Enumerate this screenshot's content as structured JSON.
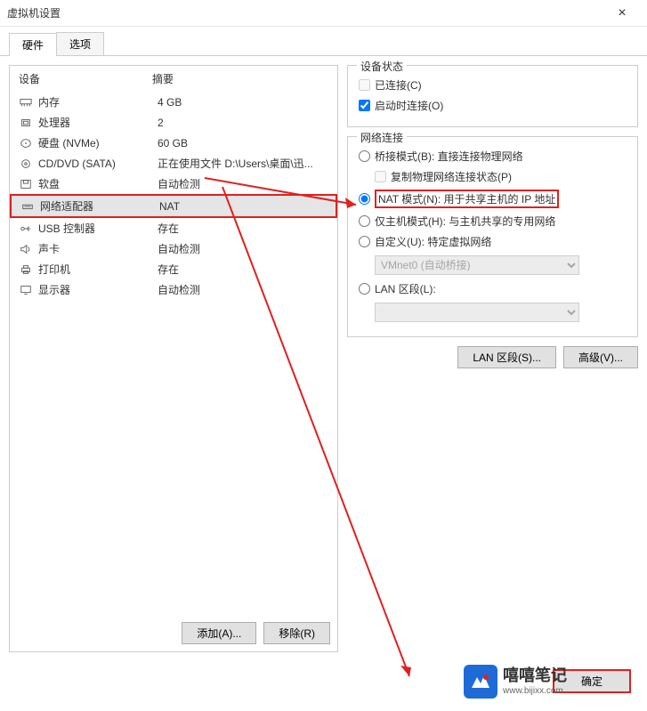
{
  "window": {
    "title": "虚拟机设置",
    "close": "×"
  },
  "tabs": {
    "hardware": "硬件",
    "options": "选项"
  },
  "headers": {
    "device": "设备",
    "summary": "摘要"
  },
  "devices": [
    {
      "name": "内存",
      "summary": "4 GB"
    },
    {
      "name": "处理器",
      "summary": "2"
    },
    {
      "name": "硬盘 (NVMe)",
      "summary": "60 GB"
    },
    {
      "name": "CD/DVD (SATA)",
      "summary": "正在使用文件 D:\\Users\\桌面\\迅..."
    },
    {
      "name": "软盘",
      "summary": "自动检测"
    },
    {
      "name": "网络适配器",
      "summary": "NAT"
    },
    {
      "name": "USB 控制器",
      "summary": "存在"
    },
    {
      "name": "声卡",
      "summary": "自动检测"
    },
    {
      "name": "打印机",
      "summary": "存在"
    },
    {
      "name": "显示器",
      "summary": "自动检测"
    }
  ],
  "leftButtons": {
    "add": "添加(A)...",
    "remove": "移除(R)"
  },
  "statusGroup": {
    "legend": "设备状态",
    "connected": "已连接(C)",
    "connectOnStart": "启动时连接(O)"
  },
  "networkGroup": {
    "legend": "网络连接",
    "bridged": "桥接模式(B): 直接连接物理网络",
    "replicate": "复制物理网络连接状态(P)",
    "nat": "NAT 模式(N): 用于共享主机的 IP 地址",
    "hostOnly": "仅主机模式(H): 与主机共享的专用网络",
    "custom": "自定义(U): 特定虚拟网络",
    "customOption": "VMnet0 (自动桥接)",
    "lanSegment": "LAN 区段(L):",
    "lanOption": ""
  },
  "rightButtons": {
    "lan": "LAN 区段(S)...",
    "advanced": "高级(V)..."
  },
  "footer": {
    "ok": "确定"
  },
  "watermark": {
    "big": "嘻嘻笔记",
    "small": "www.bijixx.com"
  }
}
